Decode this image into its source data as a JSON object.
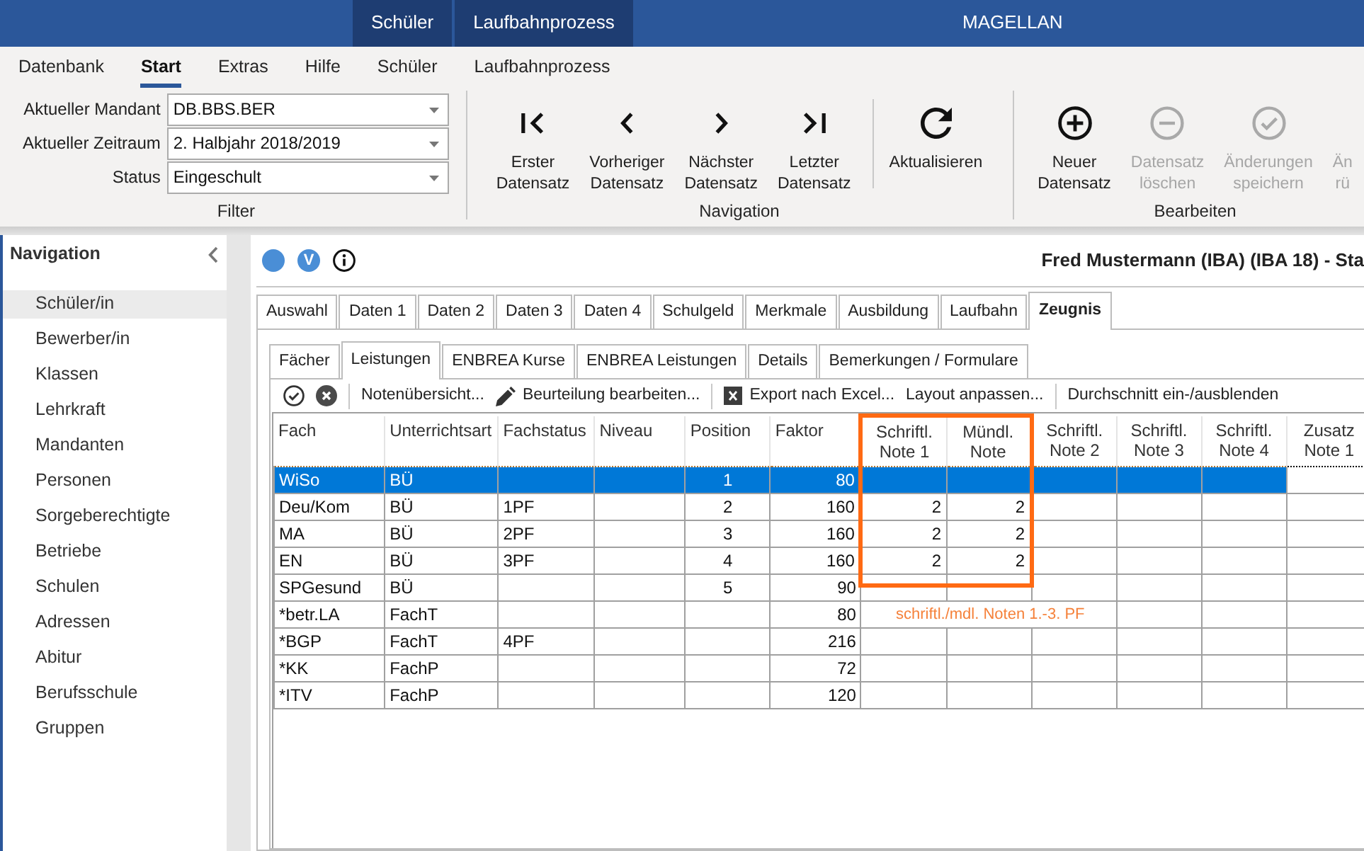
{
  "title_bar": {
    "tabs": [
      "Schüler",
      "Laufbahnprozess"
    ],
    "title": "MAGELLAN"
  },
  "menu": [
    {
      "label": "Datenbank",
      "selected": false
    },
    {
      "label": "Start",
      "selected": true
    },
    {
      "label": "Extras",
      "selected": false
    },
    {
      "label": "Hilfe",
      "selected": false
    },
    {
      "label": "Schüler",
      "selected": false
    },
    {
      "label": "Laufbahnprozess",
      "selected": false
    }
  ],
  "ribbon": {
    "filter": {
      "label": "Filter",
      "fields": [
        {
          "label": "Aktueller Mandant",
          "value": "DB.BBS.BER"
        },
        {
          "label": "Aktueller Zeitraum",
          "value": "2. Halbjahr 2018/2019"
        },
        {
          "label": "Status",
          "value": "Eingeschult"
        }
      ]
    },
    "groups": [
      {
        "label": "Navigation",
        "buttons": [
          {
            "label": "Erster Datensatz",
            "kind": "first",
            "disabled": false,
            "separated": false
          },
          {
            "label": "Vorheriger Datensatz",
            "kind": "previous",
            "disabled": false,
            "separated": false
          },
          {
            "label": "Nächster Datensatz",
            "kind": "next",
            "disabled": false,
            "separated": false
          },
          {
            "label": "Letzter Datensatz",
            "kind": "last",
            "disabled": false,
            "separated": false
          },
          {
            "label": "Aktualisieren",
            "kind": "refresh",
            "disabled": false,
            "separated": true
          }
        ]
      },
      {
        "label": "Bearbeiten",
        "buttons": [
          {
            "label": "Neuer Datensatz",
            "kind": "add",
            "disabled": false,
            "separated": false
          },
          {
            "label": "Datensatz löschen",
            "kind": "delete",
            "disabled": true,
            "separated": false
          },
          {
            "label": "Änderungen speichern",
            "kind": "save",
            "disabled": true,
            "separated": false
          },
          {
            "label": "Än rü",
            "kind": "plain",
            "disabled": true,
            "separated": false
          }
        ]
      }
    ]
  },
  "navigation": {
    "title": "Navigation",
    "items": [
      {
        "label": "Schüler/in",
        "selected": true
      },
      {
        "label": "Bewerber/in",
        "selected": false
      },
      {
        "label": "Klassen",
        "selected": false
      },
      {
        "label": "Lehrkraft",
        "selected": false
      },
      {
        "label": "Mandanten",
        "selected": false
      },
      {
        "label": "Personen",
        "selected": false
      },
      {
        "label": "Sorgeberechtigte",
        "selected": false
      },
      {
        "label": "Betriebe",
        "selected": false
      },
      {
        "label": "Schulen",
        "selected": false
      },
      {
        "label": "Adressen",
        "selected": false
      },
      {
        "label": "Abitur",
        "selected": false
      },
      {
        "label": "Berufsschule",
        "selected": false
      },
      {
        "label": "Gruppen",
        "selected": false
      }
    ]
  },
  "record": {
    "badge": "V",
    "title": "Fred Mustermann (IBA) (IBA 18) - Sta"
  },
  "tabs": [
    {
      "label": "Auswahl",
      "selected": false
    },
    {
      "label": "Daten 1",
      "selected": false
    },
    {
      "label": "Daten 2",
      "selected": false
    },
    {
      "label": "Daten 3",
      "selected": false
    },
    {
      "label": "Daten 4",
      "selected": false
    },
    {
      "label": "Schulgeld",
      "selected": false
    },
    {
      "label": "Merkmale",
      "selected": false
    },
    {
      "label": "Ausbildung",
      "selected": false
    },
    {
      "label": "Laufbahn",
      "selected": false
    },
    {
      "label": "Zeugnis",
      "selected": true
    }
  ],
  "subtabs": [
    {
      "label": "Fächer",
      "selected": false
    },
    {
      "label": "Leistungen",
      "selected": true
    },
    {
      "label": "ENBREA Kurse",
      "selected": false
    },
    {
      "label": "ENBREA Leistungen",
      "selected": false
    },
    {
      "label": "Details",
      "selected": false
    },
    {
      "label": "Bemerkungen / Formulare",
      "selected": false
    }
  ],
  "toolbar": [
    {
      "kind": "confirm",
      "separated": false
    },
    {
      "kind": "cancel",
      "separated": false
    },
    {
      "kind": "text",
      "label": "Notenübersicht...",
      "separated": true
    },
    {
      "kind": "edit",
      "label": "Beurteilung bearbeiten...",
      "separated": false
    },
    {
      "kind": "export",
      "label": "Export nach Excel...",
      "separated": true
    },
    {
      "kind": "text",
      "label": "Layout anpassen...",
      "separated": false
    },
    {
      "kind": "text",
      "label": "Durchschnitt ein-/ausblenden",
      "separated": true
    }
  ],
  "table": {
    "columns": [
      {
        "label": "Fach",
        "kind": "text",
        "highlighted": false,
        "focused": false
      },
      {
        "label": "Unterrichtsart",
        "kind": "text",
        "highlighted": false,
        "focused": false
      },
      {
        "label": "Fachstatus",
        "kind": "text",
        "highlighted": false,
        "focused": false
      },
      {
        "label": "Niveau",
        "kind": "text",
        "highlighted": false,
        "focused": false
      },
      {
        "label": "Position",
        "kind": "position",
        "highlighted": false,
        "focused": false
      },
      {
        "label": "Faktor",
        "kind": "number",
        "highlighted": false,
        "focused": false
      },
      {
        "label": "Schriftl. Note 1",
        "kind": "grade",
        "highlighted": true,
        "focused": false
      },
      {
        "label": "Mündl. Note",
        "kind": "grade",
        "highlighted": true,
        "focused": false
      },
      {
        "label": "Schriftl. Note 2",
        "kind": "grade",
        "highlighted": false,
        "focused": false
      },
      {
        "label": "Schriftl. Note 3",
        "kind": "grade",
        "highlighted": false,
        "focused": false
      },
      {
        "label": "Schriftl. Note 4",
        "kind": "grade",
        "highlighted": false,
        "focused": false
      },
      {
        "label": "Zusatz Note 1",
        "kind": "grade",
        "highlighted": false,
        "focused": true
      }
    ],
    "rows": [
      {
        "cells": [
          "WiSo",
          "BÜ",
          null,
          null,
          "1",
          "80"
        ],
        "selected": true
      },
      {
        "cells": [
          "Deu/Kom",
          "BÜ",
          "1PF",
          null,
          "2",
          "160",
          "2",
          "2"
        ],
        "selected": false
      },
      {
        "cells": [
          "MA",
          "BÜ",
          "2PF",
          null,
          "3",
          "160",
          "2",
          "2"
        ],
        "selected": false
      },
      {
        "cells": [
          "EN",
          "BÜ",
          "3PF",
          null,
          "4",
          "160",
          "2",
          "2"
        ],
        "selected": false
      },
      {
        "cells": [
          "SPGesund",
          "BÜ",
          null,
          null,
          "5",
          "90"
        ],
        "selected": false
      },
      {
        "cells": [
          "*betr.LA",
          "FachT",
          null,
          null,
          null,
          "80"
        ],
        "note": "schriftl./mdl. Noten 1.-3. PF",
        "selected": false
      },
      {
        "cells": [
          "*BGP",
          "FachT",
          "4PF",
          null,
          null,
          "216"
        ],
        "selected": false
      },
      {
        "cells": [
          "*KK",
          "FachP",
          null,
          null,
          null,
          "72"
        ],
        "selected": false
      },
      {
        "cells": [
          "*ITV",
          "FachP",
          null,
          null,
          null,
          "120"
        ],
        "selected": false
      }
    ]
  }
}
